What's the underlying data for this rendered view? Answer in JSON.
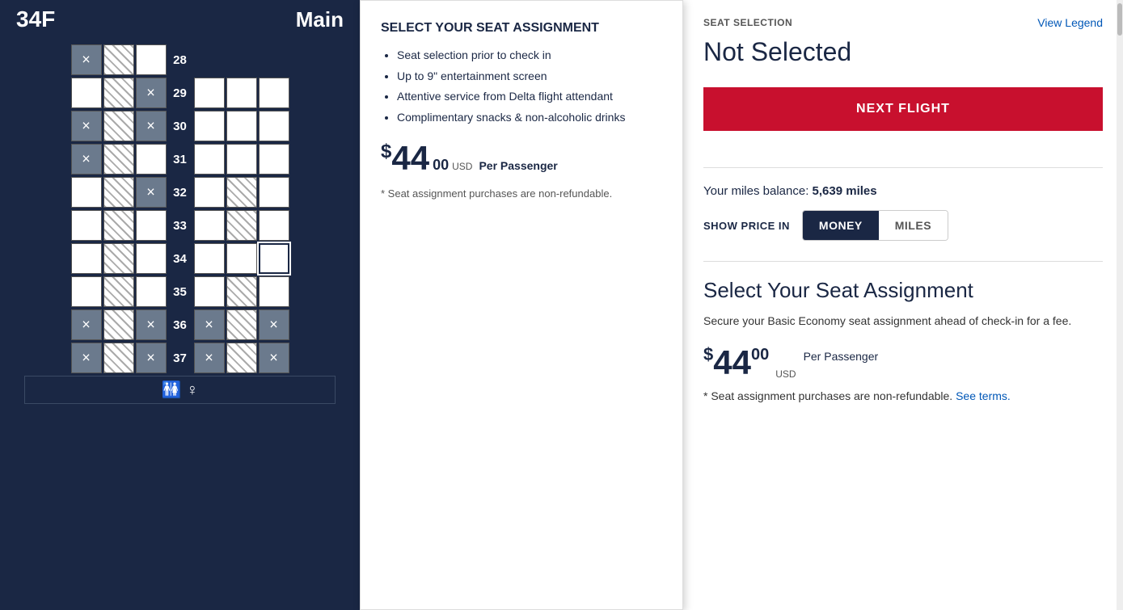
{
  "header": {
    "seat_id": "34F",
    "seat_class": "Main"
  },
  "popup": {
    "title": "SELECT YOUR SEAT ASSIGNMENT",
    "bullets": [
      "Seat selection prior to check in",
      "Up to 9\" entertainment screen",
      "Attentive service from Delta flight attendant",
      "Complimentary snacks & non-alcoholic drinks"
    ],
    "price_dollar": "$",
    "price_main": "44",
    "price_cents": "00",
    "price_usd": "USD",
    "per_passenger": "Per Passenger",
    "refund_note": "* Seat assignment purchases are non-refundable."
  },
  "right": {
    "seat_selection_label": "SEAT SELECTION",
    "view_legend": "View Legend",
    "not_selected": "Not Selected",
    "next_flight_btn": "NEXT FLIGHT",
    "miles_balance_label": "Your miles balance:",
    "miles_balance_value": "5,639 miles",
    "show_price_label": "SHOW PRICE IN",
    "toggle_money": "MONEY",
    "toggle_miles": "MILES",
    "section_title": "Select Your Seat Assignment",
    "section_desc": "Secure your Basic Economy seat assignment ahead of check-in for a fee.",
    "price_dollar": "$",
    "price_main": "44",
    "price_cents": "00",
    "price_usd": "USD",
    "per_passenger": "Per Passenger",
    "refund_note": "* Seat assignment purchases are non-refundable.",
    "see_terms": "See terms."
  },
  "rows": [
    {
      "num": "28",
      "seats": [
        {
          "type": "unavailable-x"
        },
        {
          "type": "hatched"
        },
        {
          "type": "available"
        },
        {
          "type": "gap"
        },
        {
          "type": "empty"
        },
        {
          "type": "empty"
        },
        {
          "type": "empty"
        }
      ]
    },
    {
      "num": "29",
      "seats": [
        {
          "type": "available"
        },
        {
          "type": "hatched"
        },
        {
          "type": "unavailable-x"
        },
        {
          "type": "gap"
        },
        {
          "type": "available"
        },
        {
          "type": "available"
        },
        {
          "type": "available"
        }
      ]
    },
    {
      "num": "30",
      "seats": [
        {
          "type": "unavailable-x"
        },
        {
          "type": "hatched"
        },
        {
          "type": "unavailable-x"
        },
        {
          "type": "gap"
        },
        {
          "type": "available"
        },
        {
          "type": "available"
        },
        {
          "type": "available"
        }
      ]
    },
    {
      "num": "31",
      "seats": [
        {
          "type": "unavailable-x"
        },
        {
          "type": "hatched"
        },
        {
          "type": "available"
        },
        {
          "type": "gap"
        },
        {
          "type": "available"
        },
        {
          "type": "available"
        },
        {
          "type": "available"
        }
      ]
    },
    {
      "num": "32",
      "seats": [
        {
          "type": "available"
        },
        {
          "type": "hatched"
        },
        {
          "type": "unavailable-x"
        },
        {
          "type": "gap"
        },
        {
          "type": "available"
        },
        {
          "type": "hatched"
        },
        {
          "type": "available"
        }
      ]
    },
    {
      "num": "33",
      "seats": [
        {
          "type": "available"
        },
        {
          "type": "hatched"
        },
        {
          "type": "available"
        },
        {
          "type": "gap"
        },
        {
          "type": "available"
        },
        {
          "type": "hatched"
        },
        {
          "type": "available"
        }
      ]
    },
    {
      "num": "34",
      "seats": [
        {
          "type": "available"
        },
        {
          "type": "hatched"
        },
        {
          "type": "available"
        },
        {
          "type": "gap"
        },
        {
          "type": "available"
        },
        {
          "type": "available"
        },
        {
          "type": "selected"
        }
      ]
    },
    {
      "num": "35",
      "seats": [
        {
          "type": "available"
        },
        {
          "type": "hatched"
        },
        {
          "type": "available"
        },
        {
          "type": "gap"
        },
        {
          "type": "available"
        },
        {
          "type": "hatched"
        },
        {
          "type": "available"
        }
      ]
    },
    {
      "num": "36",
      "seats": [
        {
          "type": "unavailable-x"
        },
        {
          "type": "hatched"
        },
        {
          "type": "unavailable-x"
        },
        {
          "type": "gap"
        },
        {
          "type": "unavailable-x"
        },
        {
          "type": "hatched"
        },
        {
          "type": "unavailable-x"
        }
      ]
    },
    {
      "num": "37",
      "seats": [
        {
          "type": "unavailable-x"
        },
        {
          "type": "hatched"
        },
        {
          "type": "unavailable-x"
        },
        {
          "type": "gap"
        },
        {
          "type": "unavailable-x"
        },
        {
          "type": "hatched"
        },
        {
          "type": "unavailable-x"
        }
      ]
    }
  ]
}
